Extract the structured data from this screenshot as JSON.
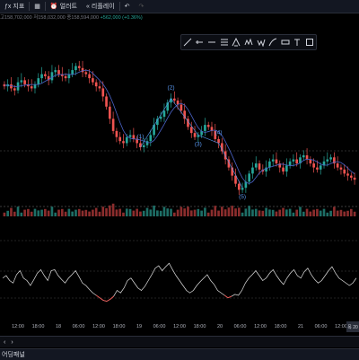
{
  "toolbar": {
    "indicators_label": "지표",
    "alert_label": "얼러트",
    "replay_label": "리플레이"
  },
  "ohlc": {
    "high": "고158,702,000",
    "low": "저158,032,000",
    "close": "종158,594,000",
    "change": "+562,000 (+0.36%)"
  },
  "drawing_tools": [
    "trend-line-icon",
    "ray-icon",
    "horizontal-line-icon",
    "fib-icon",
    "pitchfork-icon",
    "pattern-icon",
    "wave-icon",
    "brush-icon",
    "measure-icon",
    "text-icon",
    "rect-icon"
  ],
  "wave_labels": [
    "(1)",
    "(2)",
    "(3)",
    "(4)",
    "(5)"
  ],
  "time_axis": [
    "12:00",
    "18:00",
    "18",
    "06:00",
    "12:00",
    "18:00",
    "19",
    "06:00",
    "12:00",
    "18:00",
    "20",
    "06:00",
    "12:00",
    "18:00",
    "21",
    "06:00",
    "12:00"
  ],
  "time_axis_badge": "목 20",
  "panel": {
    "label": "어딩패널"
  },
  "colors": {
    "up": "#26a69a",
    "down": "#ef5350",
    "ma": "#4a63c7",
    "wave": "#5b9cf6",
    "oscillator": "#e0e0e0"
  },
  "chart_data": {
    "type": "candlestick",
    "title": "",
    "candles_close": [
      120,
      121,
      119,
      118,
      122,
      123,
      121,
      120,
      119,
      121,
      124,
      126,
      125,
      123,
      127,
      128,
      126,
      125,
      124,
      126,
      128,
      130,
      129,
      127,
      126,
      124,
      122,
      120,
      119,
      115,
      110,
      104,
      98,
      95,
      93,
      92,
      95,
      96,
      94,
      92,
      90,
      91,
      93,
      96,
      101,
      104,
      105,
      108,
      112,
      114,
      113,
      111,
      108,
      104,
      100,
      97,
      95,
      96,
      98,
      101,
      100,
      98,
      94,
      92,
      88,
      84,
      80,
      76,
      72,
      69,
      70,
      73,
      77,
      80,
      82,
      79,
      78,
      80,
      83,
      84,
      82,
      80,
      78,
      81,
      83,
      84,
      82,
      85,
      86,
      84,
      82,
      80,
      79,
      81,
      83,
      84,
      85,
      82,
      80,
      79,
      77,
      76,
      75,
      74
    ],
    "volume_baseline": true,
    "oscillator": [
      0.55,
      0.6,
      0.5,
      0.45,
      0.62,
      0.7,
      0.55,
      0.5,
      0.4,
      0.52,
      0.65,
      0.72,
      0.6,
      0.5,
      0.7,
      0.72,
      0.6,
      0.52,
      0.45,
      0.55,
      0.62,
      0.7,
      0.58,
      0.45,
      0.4,
      0.32,
      0.25,
      0.2,
      0.15,
      0.1,
      0.08,
      0.12,
      0.18,
      0.3,
      0.25,
      0.35,
      0.5,
      0.55,
      0.45,
      0.35,
      0.3,
      0.38,
      0.5,
      0.62,
      0.75,
      0.8,
      0.7,
      0.78,
      0.85,
      0.72,
      0.6,
      0.5,
      0.4,
      0.3,
      0.25,
      0.3,
      0.4,
      0.48,
      0.55,
      0.62,
      0.5,
      0.42,
      0.3,
      0.25,
      0.2,
      0.15,
      0.18,
      0.22,
      0.2,
      0.3,
      0.45,
      0.55,
      0.62,
      0.7,
      0.6,
      0.5,
      0.55,
      0.65,
      0.72,
      0.6,
      0.5,
      0.42,
      0.55,
      0.65,
      0.72,
      0.6,
      0.55,
      0.68,
      0.75,
      0.62,
      0.52,
      0.45,
      0.5,
      0.6,
      0.7,
      0.78,
      0.65,
      0.55,
      0.5,
      0.45,
      0.4,
      0.45,
      0.55
    ]
  }
}
